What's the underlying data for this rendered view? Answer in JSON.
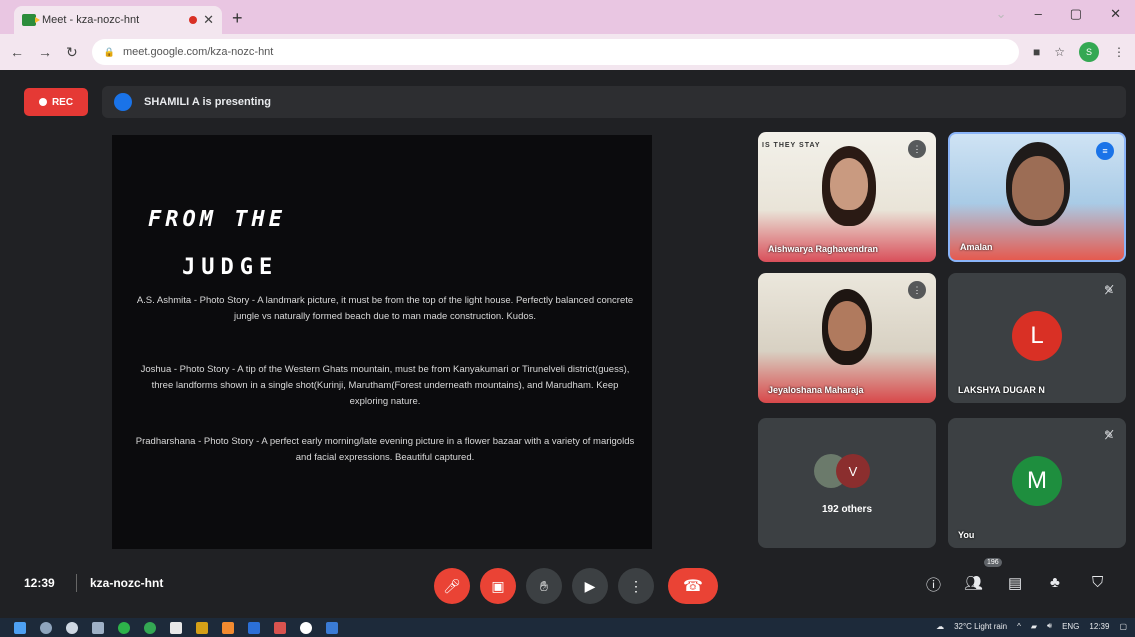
{
  "browser": {
    "tab_title": "Meet - kza-nozc-hnt",
    "url": "meet.google.com/kza-nozc-hnt",
    "new_tab_symbol": "+",
    "profile_initial": "S"
  },
  "meet": {
    "rec_label": "REC",
    "presenting_text": "SHAMILI A is presenting",
    "slide": {
      "heading_line1": "FROM THE",
      "heading_line2": "JUDGE",
      "para1": "A.S. Ashmita - Photo Story - A landmark picture, it must be from the top of the light house. Perfectly balanced concrete jungle vs naturally formed beach due to man made construction. Kudos.",
      "para2": "Joshua - Photo Story - A tip of the Western Ghats mountain, must be from Kanyakumari or Tirunelveli district(guess), three landforms shown in a single shot(Kurinji, Marutham(Forest underneath mountains), and Marudham. Keep exploring nature.",
      "para3": "Pradharshana - Photo Story - A perfect early morning/late evening picture in a flower bazaar with a variety of marigolds and facial expressions. Beautiful captured."
    },
    "participants": [
      {
        "name": "Aishwarya Raghavendran"
      },
      {
        "name": "Amalan"
      },
      {
        "name": "Jeyaloshana Maharaja"
      },
      {
        "name": "LAKSHYA DUGAR N",
        "initial": "L",
        "color": "#d93025"
      },
      {
        "name": "192 others",
        "initial": "V",
        "color": "#8b2e2e"
      },
      {
        "name": "You",
        "initial": "M",
        "color": "#1e8e3e"
      }
    ],
    "banner_text": "IS THEY STAY",
    "time": "12:39",
    "meeting_code": "kza-nozc-hnt",
    "people_count": "196"
  },
  "taskbar": {
    "weather": "32°C  Light rain",
    "lang": "ENG",
    "clock": "12:39"
  },
  "colors": {
    "accent_red": "#ea4335",
    "meet_bg": "#202124",
    "tile_bg": "#3c4043"
  }
}
